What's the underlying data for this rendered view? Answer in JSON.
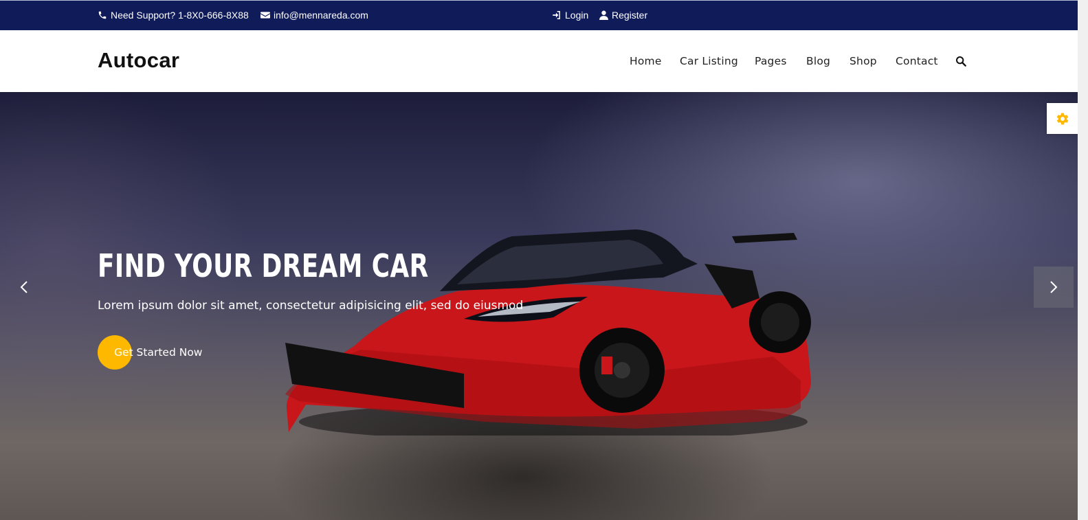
{
  "topbar": {
    "support_text": "Need Support? 1-8X0-666-8X88",
    "email": "info@mennareda.com",
    "login_label": "Login",
    "register_label": "Register"
  },
  "header": {
    "logo": "Autocar",
    "nav": [
      "Home",
      "Car Listing",
      "Pages",
      "Blog",
      "Shop",
      "Contact"
    ]
  },
  "hero": {
    "title": "FIND YOUR DREAM CAR",
    "subtitle": "Lorem ipsum dolor sit amet, consectetur adipisicing elit, sed do eiusmod",
    "cta_label": "Get Started Now"
  },
  "icons": {
    "phone": "phone-icon",
    "email": "envelope-icon",
    "login": "sign-in-icon",
    "register": "user-icon",
    "search": "search-icon",
    "settings": "gear-icon",
    "prev": "chevron-left-icon",
    "next": "chevron-right-icon"
  },
  "colors": {
    "topbar_bg": "#101c5a",
    "accent": "#ffb800",
    "car": "#d41418"
  }
}
